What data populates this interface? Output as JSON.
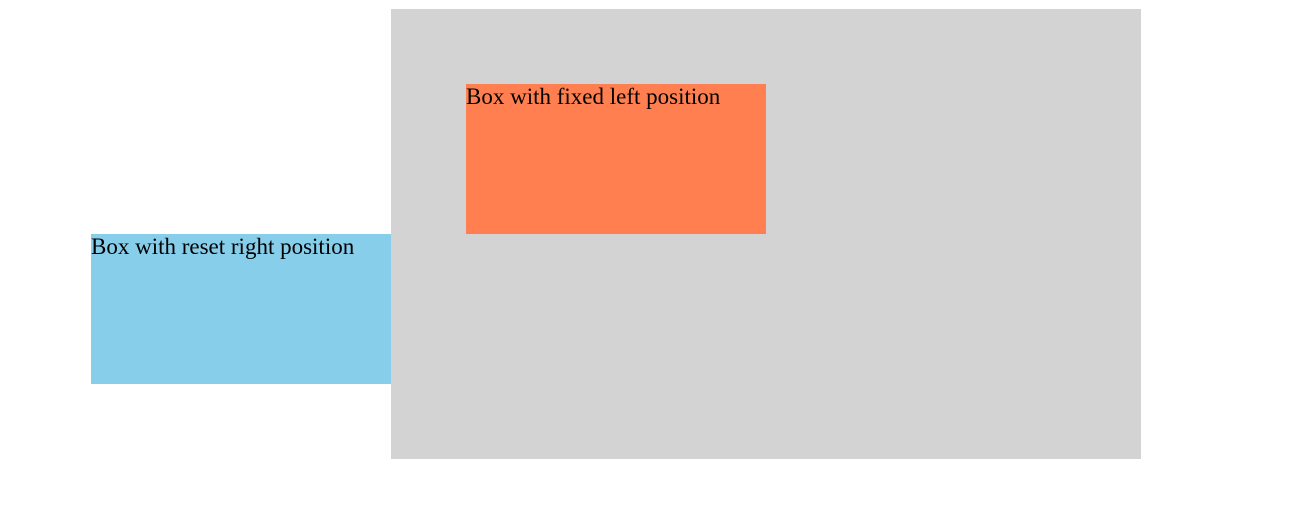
{
  "boxes": {
    "fixed_left": {
      "label": "Box with fixed left position",
      "color": "#ff7f50"
    },
    "reset_right": {
      "label": "Box with reset right position",
      "color": "#87ceeb"
    }
  },
  "container": {
    "color": "#d3d3d3"
  }
}
